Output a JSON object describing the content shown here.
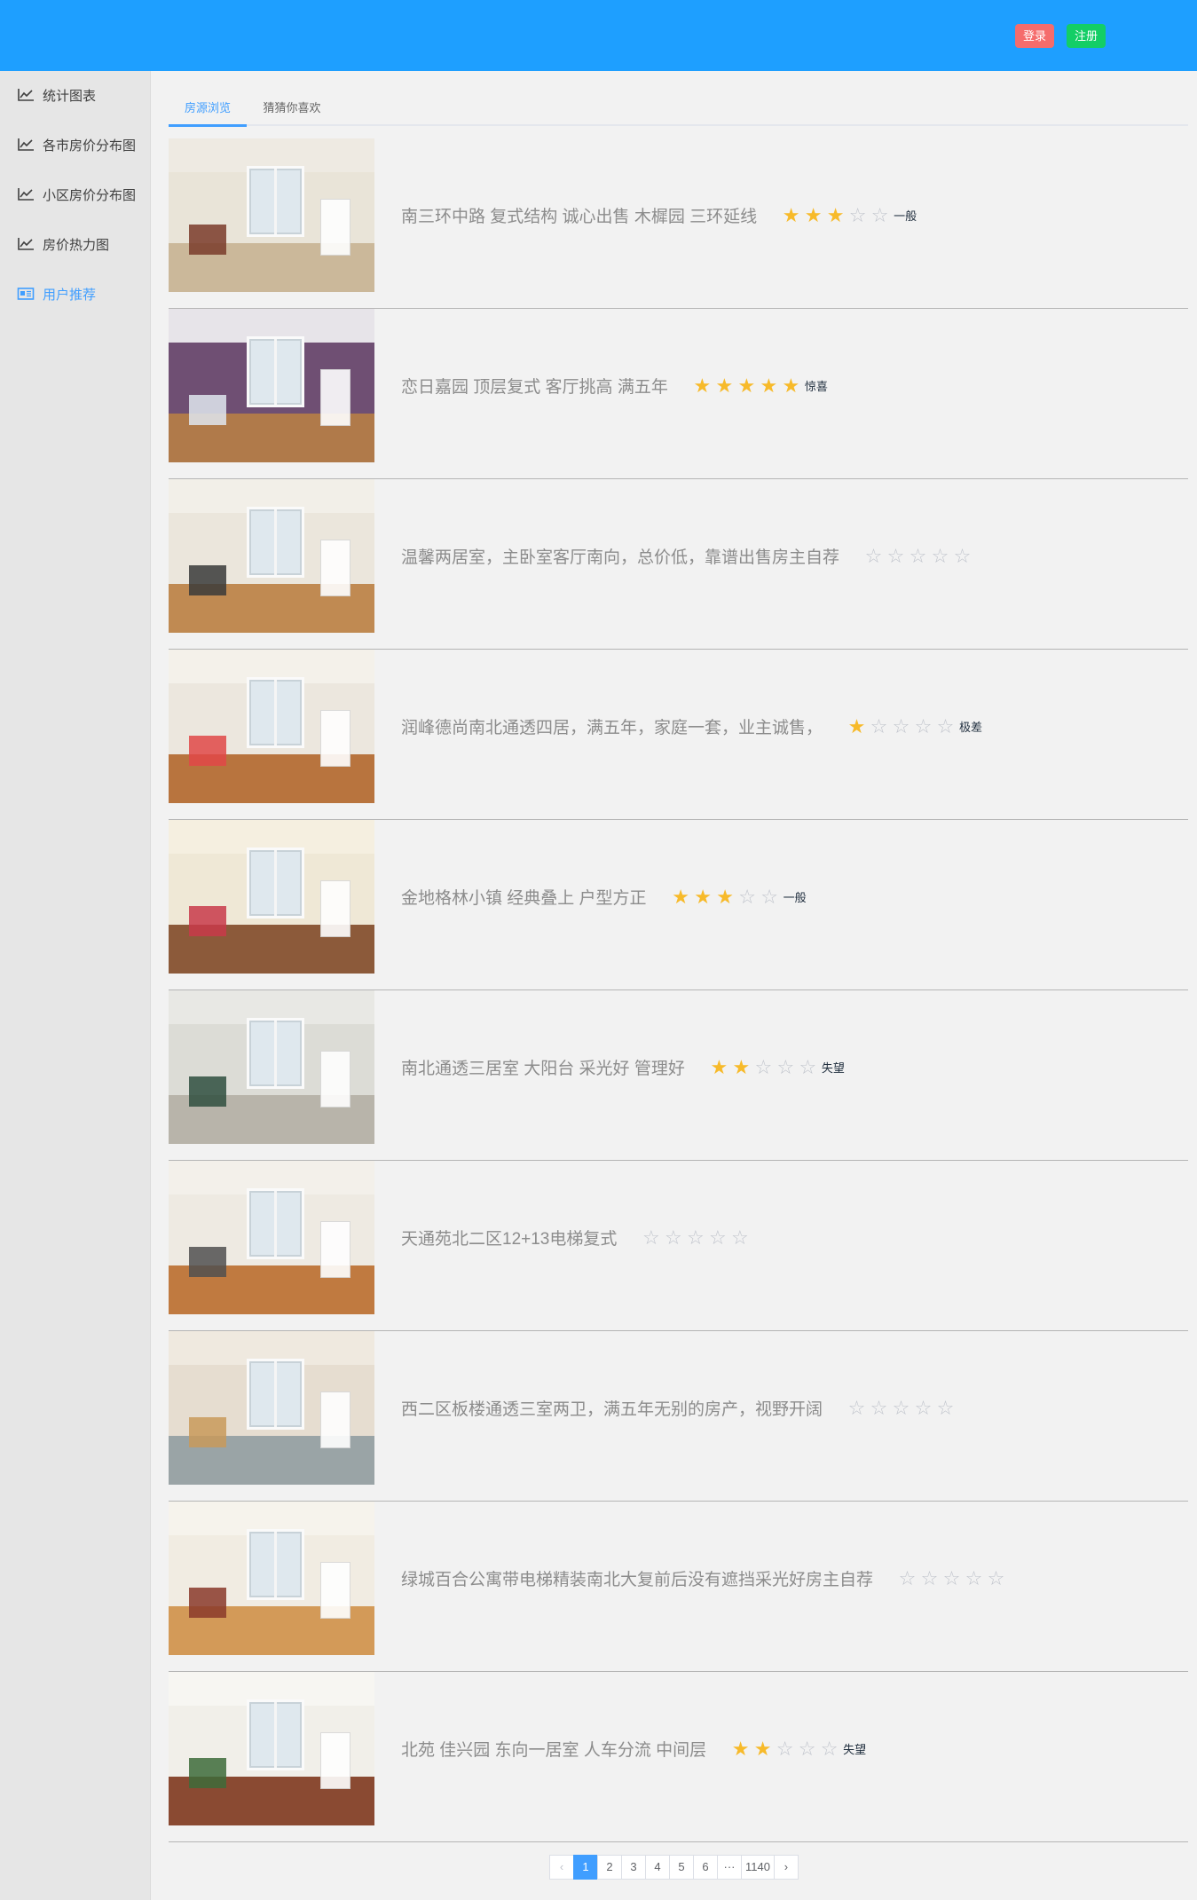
{
  "header": {
    "login_label": "登录",
    "register_label": "注册"
  },
  "sidebar": {
    "items": [
      {
        "label": "统计图表",
        "icon": "line-chart-icon"
      },
      {
        "label": "各市房价分布图",
        "icon": "line-chart-icon"
      },
      {
        "label": "小区房价分布图",
        "icon": "line-chart-icon"
      },
      {
        "label": "房价热力图",
        "icon": "line-chart-icon"
      },
      {
        "label": "用户推荐",
        "icon": "newspaper-icon",
        "active": true
      }
    ]
  },
  "tabs": [
    {
      "label": "房源浏览",
      "active": true
    },
    {
      "label": "猜猜你喜欢",
      "active": false
    }
  ],
  "listings": [
    {
      "title": "南三环中路 复式结构 诚心出售 木樨园 三环延线",
      "rating": 3,
      "rating_text": "一般"
    },
    {
      "title": "恋日嘉园 顶层复式 客厅挑高 满五年",
      "rating": 5,
      "rating_text": "惊喜"
    },
    {
      "title": "温馨两居室，主卧室客厅南向，总价低，靠谱出售房主自荐",
      "rating": 0,
      "rating_text": ""
    },
    {
      "title": "润峰德尚南北通透四居，满五年，家庭一套，业主诚售，",
      "rating": 1,
      "rating_text": "极差"
    },
    {
      "title": "金地格林小镇 经典叠上 户型方正",
      "rating": 3,
      "rating_text": "一般"
    },
    {
      "title": "南北通透三居室 大阳台 采光好 管理好",
      "rating": 2,
      "rating_text": "失望"
    },
    {
      "title": "天通苑北二区12+13电梯复式",
      "rating": 0,
      "rating_text": ""
    },
    {
      "title": "西二区板楼通透三室两卫，满五年无别的房产，视野开阔",
      "rating": 0,
      "rating_text": ""
    },
    {
      "title": "绿城百合公寓带电梯精装南北大复前后没有遮挡采光好房主自荐",
      "rating": 0,
      "rating_text": ""
    },
    {
      "title": "北苑 佳兴园 东向一居室 人车分流 中间层",
      "rating": 2,
      "rating_text": "失望"
    }
  ],
  "pagination": {
    "prev": "‹",
    "pages": [
      "1",
      "2",
      "3",
      "4",
      "5",
      "6"
    ],
    "ellipsis": "···",
    "last": "1140",
    "next": "›",
    "current": "1"
  },
  "colors": {
    "header": "#1e9fff",
    "login": "#f56c6c",
    "register": "#13ce66",
    "accent": "#409eff",
    "star_on": "#f7ba2a",
    "star_off": "#c0c4cc"
  }
}
